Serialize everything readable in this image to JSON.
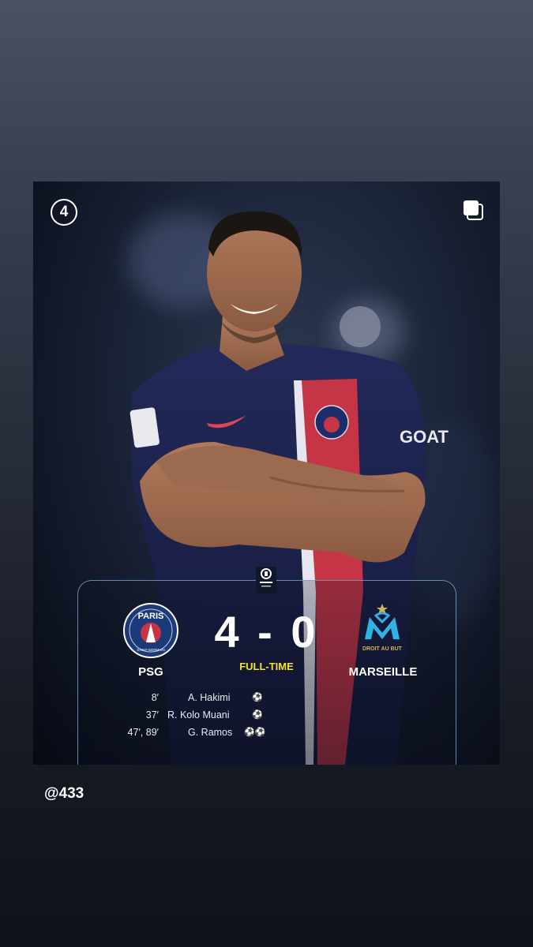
{
  "post": {
    "carousel_index": "4",
    "multi_icon": "carousel-stack-icon",
    "league_logo": "ligue-1-uber-eats-logo",
    "home_team": {
      "name": "PSG",
      "crest_text": "PARIS",
      "crest_sub": "SAINT-GERMAIN",
      "color": "#1b3a7a"
    },
    "away_team": {
      "name": "MARSEILLE",
      "crest_text": "DROIT AU BUT",
      "color": "#2fb3e4"
    },
    "score": "4 - 0",
    "status": "FULL-TIME",
    "status_color": "#f4e227",
    "jersey_sponsor": "GOAT",
    "scorers": [
      {
        "minute": "8′",
        "name": "A. Hakimi",
        "goals": "⚽"
      },
      {
        "minute": "37′",
        "name": "R. Kolo Muani",
        "goals": "⚽"
      },
      {
        "minute": "47′, 89′",
        "name": "G. Ramos",
        "goals": "⚽⚽"
      }
    ]
  },
  "handle": "@433"
}
